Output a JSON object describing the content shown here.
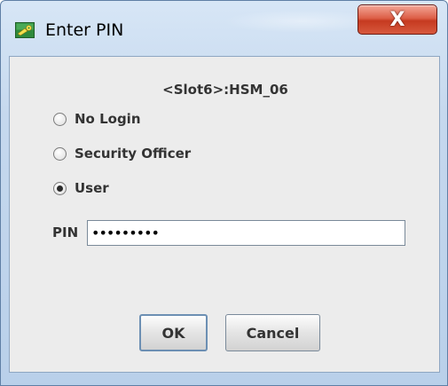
{
  "window": {
    "title": "Enter PIN",
    "close_label": "X"
  },
  "dialog": {
    "slot_label": "<Slot6>:HSM_06",
    "login_options": [
      {
        "label": "No Login",
        "selected": false
      },
      {
        "label": "Security Officer",
        "selected": false
      },
      {
        "label": "User",
        "selected": true
      }
    ],
    "pin_label": "PIN",
    "pin_value": "•••••••••",
    "ok_label": "OK",
    "cancel_label": "Cancel"
  },
  "colors": {
    "close_button": "#c63a20",
    "dialog_background": "#ececec"
  }
}
